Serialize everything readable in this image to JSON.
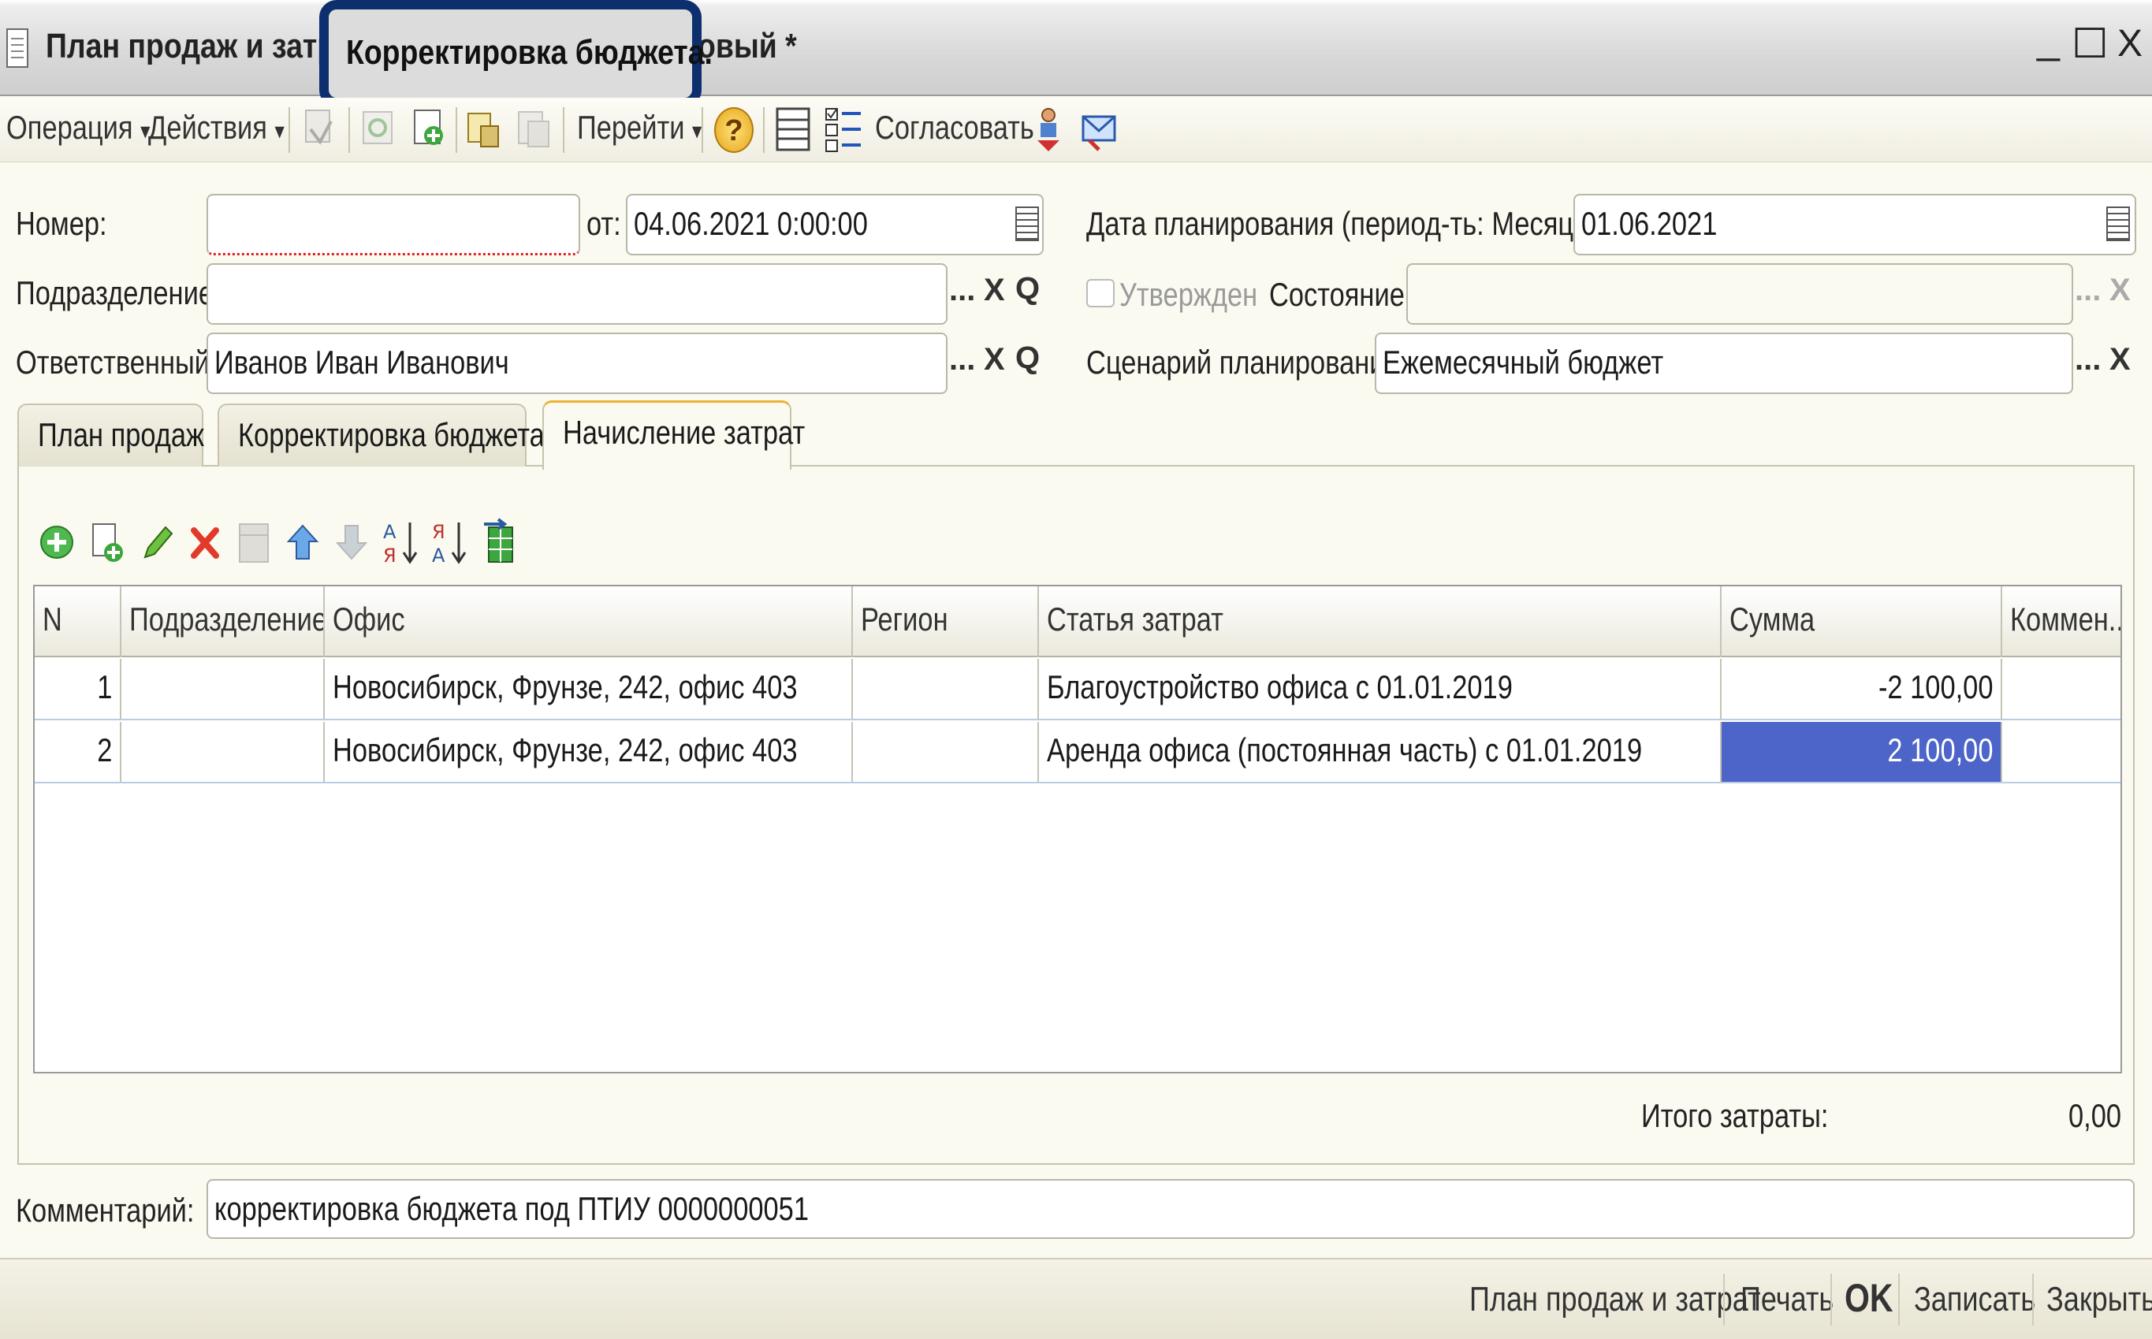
{
  "window": {
    "title_left": "План продаж и затрат",
    "title_highlight": "Корректировка бюджета.",
    "title_right": "овый *",
    "minimize": "_",
    "maximize": "☐",
    "close": "X"
  },
  "toolbar": {
    "operation": "Операция",
    "actions": "Действия",
    "goto": "Перейти",
    "approve": "Согласовать",
    "dropdown_arrow": "▾",
    "help": "?"
  },
  "form": {
    "number_label": "Номер:",
    "number_value": "",
    "date_from_label": "от:",
    "date_from_value": "04.06.2021  0:00:00",
    "planning_date_label": "Дата планирования (период-ть: Месяц):",
    "planning_date_value": "01.06.2021",
    "department_label": "Подразделение:",
    "department_value": "",
    "approved_label": "Утвержден",
    "state_label": "Состояние:",
    "state_value": "",
    "responsible_label": "Ответственный:",
    "responsible_value": "Иванов Иван Иванович",
    "scenario_label": "Сценарий планирования:",
    "scenario_value": "Ежемесячный бюджет",
    "ellipsis": "...",
    "clear": "X",
    "search": "Q"
  },
  "tabs": [
    {
      "label": "План продаж"
    },
    {
      "label": "Корректировка бюджета"
    },
    {
      "label": "Начисление затрат"
    }
  ],
  "grid": {
    "columns": [
      "N",
      "Подразделение",
      "Офис",
      "Регион",
      "Статья затрат",
      "Сумма",
      "Коммен..."
    ],
    "rows": [
      {
        "n": "1",
        "department": "",
        "office": "Новосибирск, Фрунзе, 242, офис 403",
        "region": "",
        "cost_item": "Благоустройство офиса  с 01.01.2019",
        "sum": "-2 100,00",
        "comment": ""
      },
      {
        "n": "2",
        "department": "",
        "office": "Новосибирск, Фрунзе, 242, офис 403",
        "region": "",
        "cost_item": "Аренда офиса (постоянная часть) с 01.01.2019",
        "sum": "2 100,00",
        "comment": ""
      }
    ]
  },
  "totals": {
    "label": "Итого затраты:",
    "value": "0,00"
  },
  "comment": {
    "label": "Комментарий:",
    "value": "корректировка бюджета под ПТИУ 0000000051"
  },
  "bottom_buttons": {
    "plan": "План продаж и затрат",
    "print": "Печать",
    "ok": "OK",
    "save": "Записать",
    "close": "Закрыть"
  },
  "colors": {
    "selection": "#4d64c9",
    "highlight_border": "#0d2f6e",
    "active_tab_accent": "#f0b030"
  }
}
